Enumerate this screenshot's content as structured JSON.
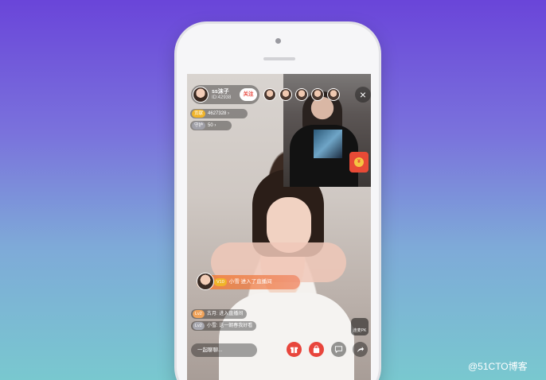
{
  "host": {
    "name": "ss沫子",
    "id": "ID:42938",
    "follow_label": "关注"
  },
  "stats": [
    {
      "tag": "贡献",
      "value": "4627328",
      "arrow": "›"
    },
    {
      "tag": "守护",
      "value": "50",
      "arrow": "›"
    }
  ],
  "close_icon": "×",
  "enter_message": {
    "badge": "V10",
    "text": "小雪 进入了直播间"
  },
  "chat": [
    {
      "level": "Lv2",
      "text": "古月: 进入直播间"
    },
    {
      "level": "Lv2",
      "text": "小雪: 送一朝春我好看"
    }
  ],
  "chat_input_placeholder": "一起聊聊...",
  "side_button_label": "连麦PK",
  "watermark": "@51CTO博客",
  "colors": {
    "accent": "#e8453c",
    "gold": "#f0b429"
  }
}
